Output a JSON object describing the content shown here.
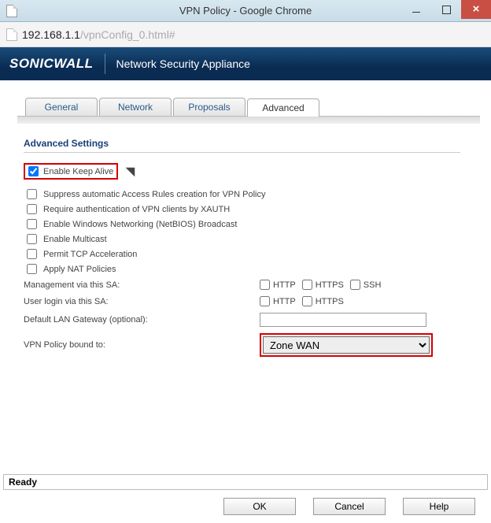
{
  "window": {
    "title": "VPN Policy - Google Chrome"
  },
  "url": {
    "host": "192.168.1.1",
    "path": "/vpnConfig_0.html#"
  },
  "header": {
    "brand": "SONICWALL",
    "subtitle": "Network Security Appliance"
  },
  "tabs": {
    "general": "General",
    "network": "Network",
    "proposals": "Proposals",
    "advanced": "Advanced"
  },
  "section": {
    "title": "Advanced Settings"
  },
  "options": {
    "keepAlive": "Enable Keep Alive",
    "suppressRules": "Suppress automatic Access Rules creation for VPN Policy",
    "requireXauth": "Require authentication of VPN clients by XAUTH",
    "netbios": "Enable Windows Networking (NetBIOS) Broadcast",
    "multicast": "Enable Multicast",
    "tcpAccel": "Permit TCP Acceleration",
    "applyNat": "Apply NAT Policies"
  },
  "rows": {
    "managementLabel": "Management via this SA:",
    "userLoginLabel": "User login via this SA:",
    "lanGatewayLabel": "Default LAN Gateway (optional):",
    "boundToLabel": "VPN Policy bound to:",
    "http": "HTTP",
    "https": "HTTPS",
    "ssh": "SSH",
    "lanGatewayValue": "",
    "boundToValue": "Zone WAN"
  },
  "status": "Ready",
  "buttons": {
    "ok": "OK",
    "cancel": "Cancel",
    "help": "Help"
  }
}
